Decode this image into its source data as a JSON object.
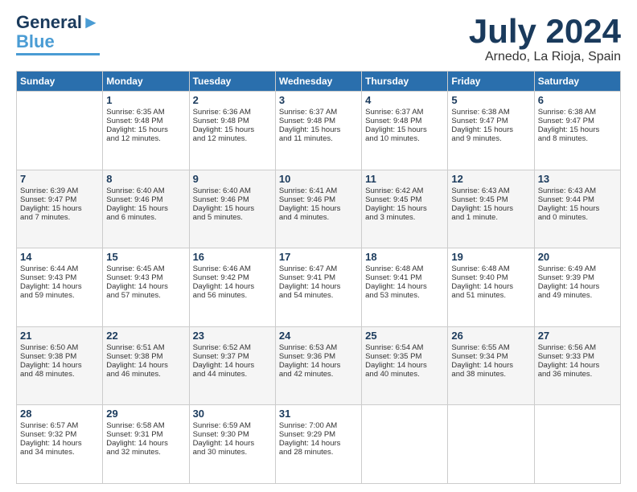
{
  "logo": {
    "line1": "General",
    "line2": "Blue"
  },
  "title": "July 2024",
  "location": "Arnedo, La Rioja, Spain",
  "days_of_week": [
    "Sunday",
    "Monday",
    "Tuesday",
    "Wednesday",
    "Thursday",
    "Friday",
    "Saturday"
  ],
  "weeks": [
    [
      {
        "day": "",
        "info": ""
      },
      {
        "day": "1",
        "info": "Sunrise: 6:35 AM\nSunset: 9:48 PM\nDaylight: 15 hours\nand 12 minutes."
      },
      {
        "day": "2",
        "info": "Sunrise: 6:36 AM\nSunset: 9:48 PM\nDaylight: 15 hours\nand 12 minutes."
      },
      {
        "day": "3",
        "info": "Sunrise: 6:37 AM\nSunset: 9:48 PM\nDaylight: 15 hours\nand 11 minutes."
      },
      {
        "day": "4",
        "info": "Sunrise: 6:37 AM\nSunset: 9:48 PM\nDaylight: 15 hours\nand 10 minutes."
      },
      {
        "day": "5",
        "info": "Sunrise: 6:38 AM\nSunset: 9:47 PM\nDaylight: 15 hours\nand 9 minutes."
      },
      {
        "day": "6",
        "info": "Sunrise: 6:38 AM\nSunset: 9:47 PM\nDaylight: 15 hours\nand 8 minutes."
      }
    ],
    [
      {
        "day": "7",
        "info": "Sunrise: 6:39 AM\nSunset: 9:47 PM\nDaylight: 15 hours\nand 7 minutes."
      },
      {
        "day": "8",
        "info": "Sunrise: 6:40 AM\nSunset: 9:46 PM\nDaylight: 15 hours\nand 6 minutes."
      },
      {
        "day": "9",
        "info": "Sunrise: 6:40 AM\nSunset: 9:46 PM\nDaylight: 15 hours\nand 5 minutes."
      },
      {
        "day": "10",
        "info": "Sunrise: 6:41 AM\nSunset: 9:46 PM\nDaylight: 15 hours\nand 4 minutes."
      },
      {
        "day": "11",
        "info": "Sunrise: 6:42 AM\nSunset: 9:45 PM\nDaylight: 15 hours\nand 3 minutes."
      },
      {
        "day": "12",
        "info": "Sunrise: 6:43 AM\nSunset: 9:45 PM\nDaylight: 15 hours\nand 1 minute."
      },
      {
        "day": "13",
        "info": "Sunrise: 6:43 AM\nSunset: 9:44 PM\nDaylight: 15 hours\nand 0 minutes."
      }
    ],
    [
      {
        "day": "14",
        "info": "Sunrise: 6:44 AM\nSunset: 9:43 PM\nDaylight: 14 hours\nand 59 minutes."
      },
      {
        "day": "15",
        "info": "Sunrise: 6:45 AM\nSunset: 9:43 PM\nDaylight: 14 hours\nand 57 minutes."
      },
      {
        "day": "16",
        "info": "Sunrise: 6:46 AM\nSunset: 9:42 PM\nDaylight: 14 hours\nand 56 minutes."
      },
      {
        "day": "17",
        "info": "Sunrise: 6:47 AM\nSunset: 9:41 PM\nDaylight: 14 hours\nand 54 minutes."
      },
      {
        "day": "18",
        "info": "Sunrise: 6:48 AM\nSunset: 9:41 PM\nDaylight: 14 hours\nand 53 minutes."
      },
      {
        "day": "19",
        "info": "Sunrise: 6:48 AM\nSunset: 9:40 PM\nDaylight: 14 hours\nand 51 minutes."
      },
      {
        "day": "20",
        "info": "Sunrise: 6:49 AM\nSunset: 9:39 PM\nDaylight: 14 hours\nand 49 minutes."
      }
    ],
    [
      {
        "day": "21",
        "info": "Sunrise: 6:50 AM\nSunset: 9:38 PM\nDaylight: 14 hours\nand 48 minutes."
      },
      {
        "day": "22",
        "info": "Sunrise: 6:51 AM\nSunset: 9:38 PM\nDaylight: 14 hours\nand 46 minutes."
      },
      {
        "day": "23",
        "info": "Sunrise: 6:52 AM\nSunset: 9:37 PM\nDaylight: 14 hours\nand 44 minutes."
      },
      {
        "day": "24",
        "info": "Sunrise: 6:53 AM\nSunset: 9:36 PM\nDaylight: 14 hours\nand 42 minutes."
      },
      {
        "day": "25",
        "info": "Sunrise: 6:54 AM\nSunset: 9:35 PM\nDaylight: 14 hours\nand 40 minutes."
      },
      {
        "day": "26",
        "info": "Sunrise: 6:55 AM\nSunset: 9:34 PM\nDaylight: 14 hours\nand 38 minutes."
      },
      {
        "day": "27",
        "info": "Sunrise: 6:56 AM\nSunset: 9:33 PM\nDaylight: 14 hours\nand 36 minutes."
      }
    ],
    [
      {
        "day": "28",
        "info": "Sunrise: 6:57 AM\nSunset: 9:32 PM\nDaylight: 14 hours\nand 34 minutes."
      },
      {
        "day": "29",
        "info": "Sunrise: 6:58 AM\nSunset: 9:31 PM\nDaylight: 14 hours\nand 32 minutes."
      },
      {
        "day": "30",
        "info": "Sunrise: 6:59 AM\nSunset: 9:30 PM\nDaylight: 14 hours\nand 30 minutes."
      },
      {
        "day": "31",
        "info": "Sunrise: 7:00 AM\nSunset: 9:29 PM\nDaylight: 14 hours\nand 28 minutes."
      },
      {
        "day": "",
        "info": ""
      },
      {
        "day": "",
        "info": ""
      },
      {
        "day": "",
        "info": ""
      }
    ]
  ]
}
